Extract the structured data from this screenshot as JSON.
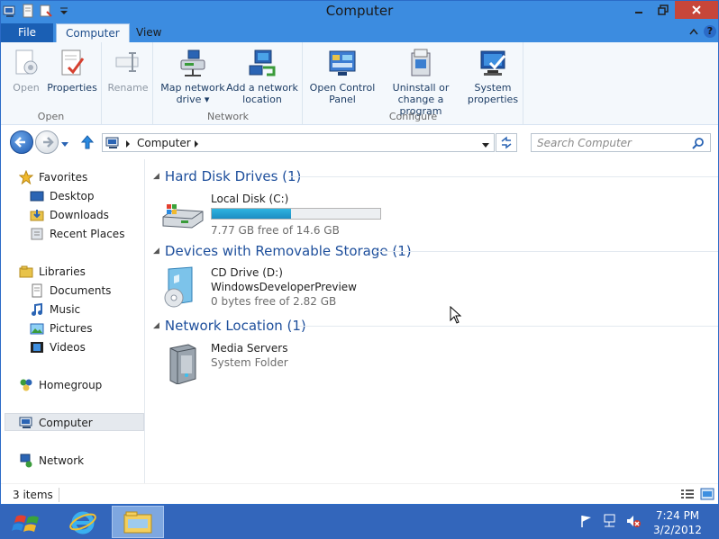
{
  "window": {
    "title": "Computer"
  },
  "ribbon_tabs": {
    "file": "File",
    "computer": "Computer",
    "view": "View"
  },
  "ribbon": {
    "open": "Open",
    "properties": "Properties",
    "rename": "Rename",
    "map_network_drive_1": "Map network",
    "map_network_drive_2": "drive ▾",
    "add_network_location_1": "Add a network",
    "add_network_location_2": "location",
    "open_control_panel_1": "Open Control",
    "open_control_panel_2": "Panel",
    "uninstall_1": "Uninstall or",
    "uninstall_2": "change a program",
    "system_properties_1": "System",
    "system_properties_2": "properties",
    "group_open": "Open",
    "group_network": "Network",
    "group_configure": "Configure"
  },
  "address": {
    "crumb": "Computer",
    "search_placeholder": "Search Computer"
  },
  "nav": {
    "favorites": "Favorites",
    "desktop": "Desktop",
    "downloads": "Downloads",
    "recent_places": "Recent Places",
    "libraries": "Libraries",
    "documents": "Documents",
    "music": "Music",
    "pictures": "Pictures",
    "videos": "Videos",
    "homegroup": "Homegroup",
    "computer": "Computer",
    "network": "Network"
  },
  "groups": {
    "hdd": "Hard Disk Drives (1)",
    "removable": "Devices with Removable Storage (1)",
    "network": "Network Location (1)"
  },
  "drives": {
    "c_name": "Local Disk (C:)",
    "c_free": "7.77 GB free of 14.6 GB",
    "c_used_fraction": 0.47,
    "d_name": "CD Drive (D:)",
    "d_label": "WindowsDeveloperPreview",
    "d_free": "0 bytes free of 2.82 GB",
    "media_name": "Media Servers",
    "media_type": "System Folder"
  },
  "status": {
    "count": "3 items"
  },
  "clock": {
    "time": "7:24 PM",
    "date": "3/2/2012"
  },
  "colors": {
    "accent": "#3c8ce0",
    "taskbar": "#3366bb",
    "group_heading": "#1e4f9c",
    "close": "#c7463a"
  }
}
